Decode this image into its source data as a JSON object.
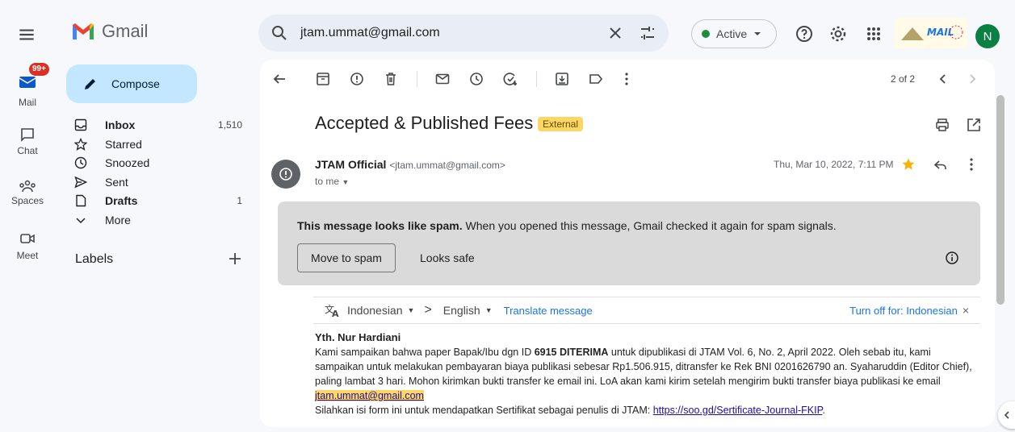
{
  "app": {
    "name": "Gmail"
  },
  "search": {
    "query": "jtam.ummat@gmail.com"
  },
  "status": {
    "label": "Active",
    "color": "#1e8e3e"
  },
  "profile": {
    "initial": "N",
    "brand_alt": "MAIL"
  },
  "rail": {
    "mail": {
      "label": "Mail",
      "badge": "99+"
    },
    "chat": {
      "label": "Chat"
    },
    "spaces": {
      "label": "Spaces"
    },
    "meet": {
      "label": "Meet"
    }
  },
  "compose": {
    "label": "Compose"
  },
  "folders": [
    {
      "label": "Inbox",
      "count": "1,510",
      "icon": "inbox-icon"
    },
    {
      "label": "Starred",
      "count": "",
      "icon": "star-icon"
    },
    {
      "label": "Snoozed",
      "count": "",
      "icon": "clock-icon"
    },
    {
      "label": "Sent",
      "count": "",
      "icon": "send-icon"
    },
    {
      "label": "Drafts",
      "count": "1",
      "icon": "draft-icon"
    },
    {
      "label": "More",
      "count": "",
      "icon": "chevron-down-icon"
    }
  ],
  "labels": {
    "heading": "Labels"
  },
  "pagination": {
    "text": "2 of 2"
  },
  "email": {
    "subject": "Accepted & Published Fees",
    "tag": "External",
    "sender_name": "JTAM Official",
    "sender_email": "<jtam.ummat@gmail.com>",
    "recipient": "to me",
    "date": "Thu, Mar 10, 2022, 7:11 PM",
    "spam_warning_bold": "This message looks like spam.",
    "spam_warning_rest": " When you opened this message, Gmail checked it again for spam signals.",
    "move_to_spam": "Move to spam",
    "looks_safe": "Looks safe",
    "translate": {
      "from": "Indonesian",
      "arrow": ">",
      "to": "English",
      "action": "Translate message",
      "turn_off": "Turn off for: Indonesian"
    },
    "greeting": "Yth. Nur Hardiani",
    "body_1": "Kami sampaikan bahwa paper Bapak/Ibu dgn ID ",
    "body_bold": "6915 DITERIMA",
    "body_2": " untuk dipublikasi di JTAM Vol. 6, No. 2, April 2022. Oleh sebab itu, kami sampaikan untuk melakukan pembayaran biaya publikasi sebesar Rp1.506.915, ditransfer ke Rek BNI 0201626790 an. Syaharuddin  (Editor Chief), paling lambat 3 hari. Mohon kirimkan bukti transfer ke email ini. LoA akan kami kirim setelah mengirim bukti transfer biaya publikasi ke email ",
    "body_email_link": "jtam.ummat@gmail.com",
    "body_3": "Silahkan isi form ini untuk mendapatkan Sertifikat sebagai penulis di JTAM: ",
    "body_form_link": "https://soo.gd/Sertificate-Journal-FKIP",
    "body_3_end": "."
  }
}
